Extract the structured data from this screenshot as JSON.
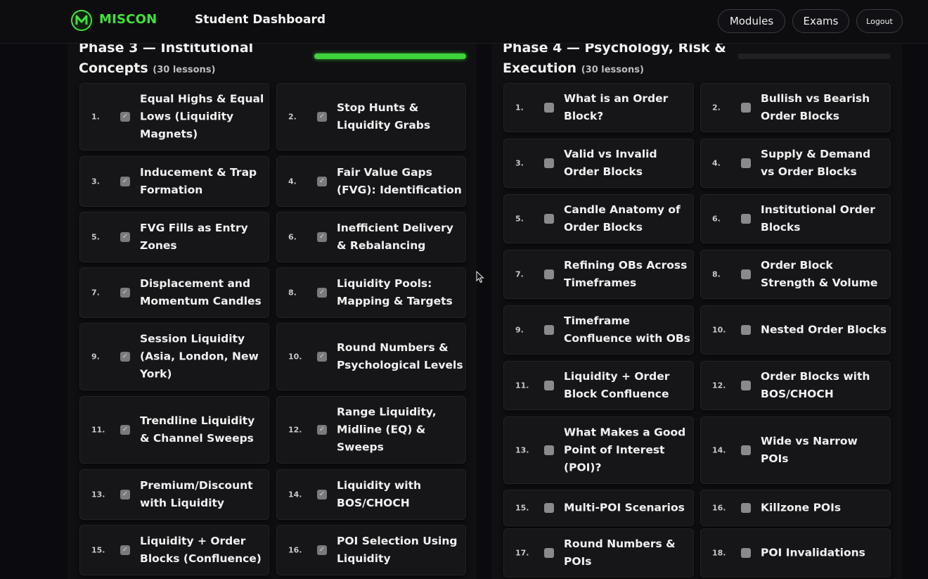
{
  "header": {
    "brand": "MISCON",
    "title": "Student Dashboard",
    "nav": {
      "modules": "Modules",
      "exams": "Exams",
      "logout": "Logout"
    }
  },
  "accent": "#41e23a",
  "phases": [
    {
      "title": "Phase 3 — Institutional Concepts",
      "count": "(30 lessons)",
      "progress": 1.0,
      "lessons": [
        {
          "n": "1.",
          "title": "Equal Highs & Equal Lows (Liquidity Magnets)",
          "done": true
        },
        {
          "n": "2.",
          "title": "Stop Hunts & Liquidity Grabs",
          "done": true
        },
        {
          "n": "3.",
          "title": "Inducement & Trap Formation",
          "done": true
        },
        {
          "n": "4.",
          "title": "Fair Value Gaps (FVG): Identification",
          "done": true
        },
        {
          "n": "5.",
          "title": "FVG Fills as Entry Zones",
          "done": true
        },
        {
          "n": "6.",
          "title": "Inefficient Delivery & Rebalancing",
          "done": true
        },
        {
          "n": "7.",
          "title": "Displacement and Momentum Candles",
          "done": true
        },
        {
          "n": "8.",
          "title": "Liquidity Pools: Mapping & Targets",
          "done": true
        },
        {
          "n": "9.",
          "title": "Session Liquidity (Asia, London, New York)",
          "done": true
        },
        {
          "n": "10.",
          "title": "Round Numbers & Psychological Levels",
          "done": true
        },
        {
          "n": "11.",
          "title": "Trendline Liquidity & Channel Sweeps",
          "done": true
        },
        {
          "n": "12.",
          "title": "Range Liquidity, Midline (EQ) & Sweeps",
          "done": true
        },
        {
          "n": "13.",
          "title": "Premium/Discount with Liquidity",
          "done": true
        },
        {
          "n": "14.",
          "title": "Liquidity with BOS/CHOCH",
          "done": true
        },
        {
          "n": "15.",
          "title": "Liquidity + Order Blocks (Confluence)",
          "done": true
        },
        {
          "n": "16.",
          "title": "POI Selection Using Liquidity",
          "done": true
        }
      ]
    },
    {
      "title": "Phase 4 — Psychology, Risk & Execution",
      "count": "(30 lessons)",
      "progress": 0.0,
      "lessons": [
        {
          "n": "1.",
          "title": "What is an Order Block?",
          "done": false
        },
        {
          "n": "2.",
          "title": "Bullish vs Bearish Order Blocks",
          "done": false
        },
        {
          "n": "3.",
          "title": "Valid vs Invalid Order Blocks",
          "done": false
        },
        {
          "n": "4.",
          "title": "Supply & Demand vs Order Blocks",
          "done": false
        },
        {
          "n": "5.",
          "title": "Candle Anatomy of Order Blocks",
          "done": false
        },
        {
          "n": "6.",
          "title": "Institutional Order Blocks",
          "done": false
        },
        {
          "n": "7.",
          "title": "Refining OBs Across Timeframes",
          "done": false
        },
        {
          "n": "8.",
          "title": "Order Block Strength & Volume",
          "done": false
        },
        {
          "n": "9.",
          "title": "Timeframe Confluence with OBs",
          "done": false
        },
        {
          "n": "10.",
          "title": "Nested Order Blocks",
          "done": false
        },
        {
          "n": "11.",
          "title": "Liquidity + Order Block Confluence",
          "done": false
        },
        {
          "n": "12.",
          "title": "Order Blocks with BOS/CHOCH",
          "done": false
        },
        {
          "n": "13.",
          "title": "What Makes a Good Point of Interest (POI)?",
          "done": false
        },
        {
          "n": "14.",
          "title": "Wide vs Narrow POIs",
          "done": false
        },
        {
          "n": "15.",
          "title": "Multi-POI Scenarios",
          "done": false
        },
        {
          "n": "16.",
          "title": "Killzone POIs",
          "done": false
        },
        {
          "n": "17.",
          "title": "Round Numbers & POIs",
          "done": false
        },
        {
          "n": "18.",
          "title": "POI Invalidations",
          "done": false
        }
      ]
    }
  ]
}
